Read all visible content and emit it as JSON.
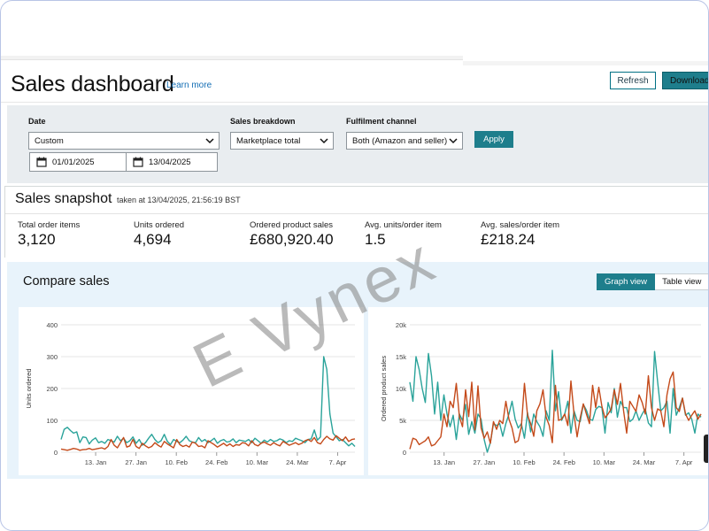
{
  "header": {
    "title": "Sales dashboard",
    "learn_more": "Learn more",
    "refresh": "Refresh",
    "download": "Download"
  },
  "filters": {
    "date_label": "Date",
    "date_range": "Custom",
    "start_date": "01/01/2025",
    "end_date": "13/04/2025",
    "breakdown_label": "Sales breakdown",
    "breakdown_value": "Marketplace total",
    "channel_label": "Fulfilment channel",
    "channel_value": "Both (Amazon and seller)",
    "apply": "Apply"
  },
  "snapshot": {
    "title": "Sales snapshot",
    "timestamp": "taken at 13/04/2025, 21:56:19 BST",
    "metrics": [
      {
        "label": "Total order items",
        "value": "3,120"
      },
      {
        "label": "Units ordered",
        "value": "4,694"
      },
      {
        "label": "Ordered product sales",
        "value": "£680,920.40"
      },
      {
        "label": "Avg. units/order item",
        "value": "1.5"
      },
      {
        "label": "Avg. sales/order item",
        "value": "£218.24"
      }
    ]
  },
  "compare": {
    "title": "Compare sales",
    "graph_view": "Graph view",
    "table_view": "Table view"
  },
  "watermark": "E Vynex",
  "colors": {
    "accent": "#1e7e8c",
    "series_teal": "#2aa39a",
    "series_rust": "#c44a1a"
  },
  "chart_data": [
    {
      "type": "line",
      "ylabel": "Units ordered",
      "ylim": [
        0,
        400
      ],
      "yticks": [
        "0",
        "100",
        "200",
        "300",
        "400"
      ],
      "xticks": [
        "13. Jan",
        "27. Jan",
        "10. Feb",
        "24. Feb",
        "10. Mar",
        "24. Mar",
        "7. Apr"
      ],
      "x_dates": [
        "2025-01-01",
        "2025-04-13"
      ],
      "series": [
        {
          "color": "teal",
          "values": [
            40,
            72,
            78,
            68,
            60,
            64,
            30,
            48,
            46,
            26,
            38,
            45,
            30,
            34,
            28,
            40,
            36,
            32,
            50,
            36,
            44,
            30,
            36,
            48,
            28,
            40,
            22,
            30,
            44,
            56,
            40,
            30,
            36,
            56,
            34,
            24,
            40,
            34,
            30,
            38,
            50,
            36,
            32,
            30,
            46,
            34,
            40,
            30,
            36,
            44,
            28,
            36,
            40,
            32,
            34,
            42,
            30,
            38,
            36,
            34,
            40,
            30,
            44,
            36,
            28,
            38,
            32,
            40,
            34,
            36,
            42,
            38,
            30,
            36,
            34,
            44,
            40,
            36,
            30,
            40,
            42,
            70,
            38,
            48,
            300,
            260,
            120,
            60,
            48,
            36,
            40,
            30,
            20,
            28,
            18
          ]
        },
        {
          "color": "rust",
          "values": [
            10,
            8,
            6,
            9,
            12,
            10,
            6,
            8,
            9,
            12,
            8,
            10,
            12,
            14,
            10,
            18,
            40,
            22,
            14,
            30,
            46,
            16,
            20,
            40,
            18,
            12,
            28,
            20,
            14,
            18,
            30,
            22,
            16,
            34,
            26,
            20,
            14,
            40,
            24,
            18,
            22,
            16,
            32,
            28,
            18,
            20,
            14,
            36,
            30,
            24,
            16,
            22,
            28,
            20,
            26,
            18,
            24,
            22,
            30,
            28,
            20,
            36,
            24,
            20,
            28,
            32,
            26,
            22,
            30,
            24,
            20,
            34,
            28,
            22,
            26,
            30,
            24,
            28,
            36,
            40,
            34,
            46,
            30,
            26,
            40,
            50,
            42,
            38,
            52,
            44,
            36,
            48,
            34,
            40,
            42
          ]
        }
      ]
    },
    {
      "type": "line",
      "ylabel": "Ordered product sales",
      "ylim": [
        0,
        20000
      ],
      "yticks": [
        "0",
        "5k",
        "10k",
        "15k",
        "20k"
      ],
      "xticks": [
        "13. Jan",
        "27. Jan",
        "10. Feb",
        "24. Feb",
        "10. Mar",
        "24. Mar",
        "7. Apr"
      ],
      "x_dates": [
        "2025-01-01",
        "2025-04-13"
      ],
      "series": [
        {
          "color": "teal",
          "values": [
            11000,
            8000,
            15000,
            13000,
            10000,
            7800,
            15500,
            12000,
            6000,
            11000,
            5000,
            9000,
            6000,
            4000,
            5800,
            2000,
            6000,
            5000,
            7500,
            2800,
            4800,
            3000,
            6000,
            5200,
            2000,
            0,
            1500,
            4500,
            4200,
            4500,
            2500,
            4500,
            6000,
            8000,
            5200,
            3800,
            4500,
            2200,
            6200,
            3200,
            6000,
            4800,
            4000,
            2500,
            6500,
            5000,
            16000,
            6500,
            9500,
            5000,
            6000,
            8000,
            3000,
            6500,
            5000,
            4800,
            7500,
            6600,
            5200,
            5000,
            6700,
            7200,
            7000,
            3000,
            7800,
            6200,
            10000,
            5500,
            8000,
            7000,
            7000,
            4800,
            5200,
            6500,
            5000,
            6000,
            6800,
            4600,
            4000,
            15800,
            11000,
            6500,
            7000,
            8000,
            3000,
            10000,
            5800,
            7000,
            8500,
            5800,
            6200,
            5200,
            3000,
            6000,
            5500
          ]
        },
        {
          "color": "rust",
          "values": [
            500,
            2200,
            2000,
            1200,
            1500,
            1800,
            2400,
            1000,
            1200,
            1800,
            2400,
            6000,
            4000,
            8000,
            7000,
            10800,
            5600,
            4000,
            9800,
            5600,
            11000,
            3500,
            10400,
            3800,
            2200,
            3200,
            1400,
            4800,
            3600,
            5000,
            4500,
            8000,
            5200,
            3800,
            1500,
            1800,
            4000,
            10800,
            5800,
            4500,
            2500,
            6500,
            7600,
            9800,
            5500,
            4200,
            1500,
            10500,
            5000,
            5200,
            6000,
            4200,
            11200,
            6000,
            2400,
            5400,
            7600,
            6000,
            4500,
            10500,
            7000,
            10200,
            7200,
            5400,
            6000,
            6800,
            9800,
            7500,
            10800,
            6500,
            3000,
            8000,
            7200,
            6400,
            9000,
            7800,
            6000,
            12000,
            7000,
            5000,
            6800,
            6500,
            4000,
            9000,
            11500,
            12600,
            7000,
            6400,
            8500,
            6000,
            5000,
            5800,
            6500,
            5200,
            6000
          ]
        }
      ]
    }
  ]
}
